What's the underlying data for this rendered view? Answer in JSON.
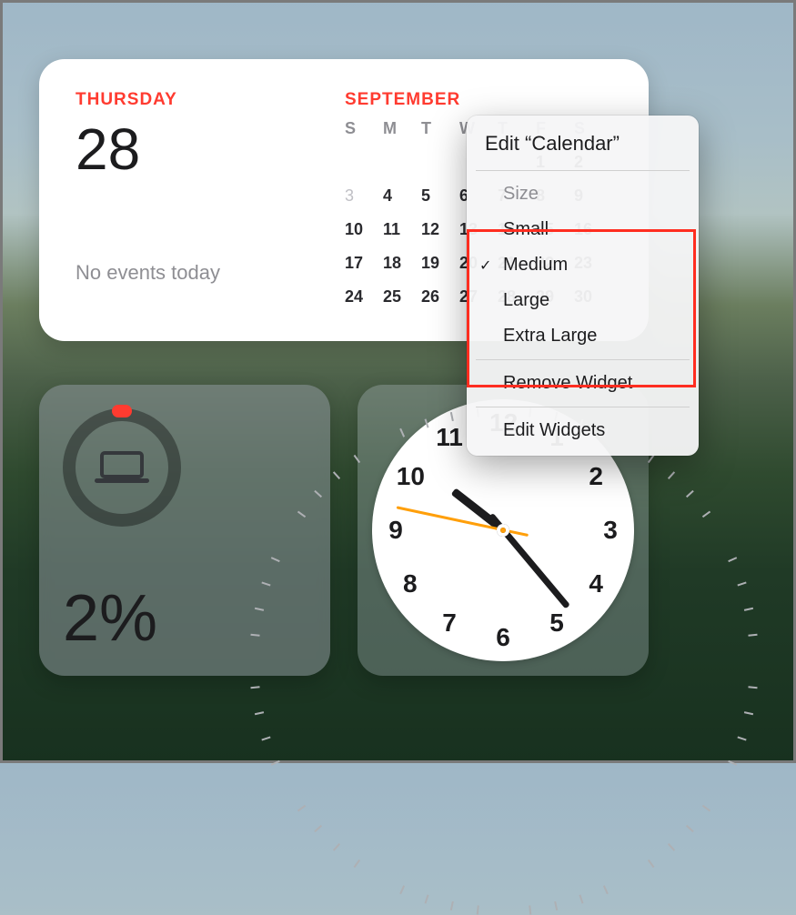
{
  "calendar": {
    "dayname": "THURSDAY",
    "daynum": "28",
    "month_label": "SEPTEMBER",
    "no_events": "No events today",
    "dayheaders": [
      "S",
      "M",
      "T",
      "W",
      "T",
      "F",
      "S"
    ],
    "rows": [
      [
        "",
        "",
        "",
        "",
        "",
        "1",
        "2"
      ],
      [
        "3",
        "4",
        "5",
        "6",
        "7",
        "8",
        "9"
      ],
      [
        "10",
        "11",
        "12",
        "13",
        "14",
        "15",
        "16"
      ],
      [
        "17",
        "18",
        "19",
        "20",
        "21",
        "22",
        "23"
      ],
      [
        "24",
        "25",
        "26",
        "27",
        "28",
        "29",
        "30"
      ]
    ]
  },
  "battery": {
    "percent_label": "2%",
    "percent_value": 2
  },
  "clock": {
    "hour": 10,
    "minute": 23,
    "numbers": [
      "12",
      "1",
      "2",
      "3",
      "4",
      "5",
      "6",
      "7",
      "8",
      "9",
      "10",
      "11"
    ]
  },
  "menu": {
    "edit_title_prefix": "Edit “",
    "edit_title_name": "Calendar",
    "edit_title_suffix": "”",
    "size_header": "Size",
    "sizes": [
      "Small",
      "Medium",
      "Large",
      "Extra Large"
    ],
    "selected_size_index": 1,
    "remove_label": "Remove Widget",
    "edit_widgets_label": "Edit Widgets"
  }
}
